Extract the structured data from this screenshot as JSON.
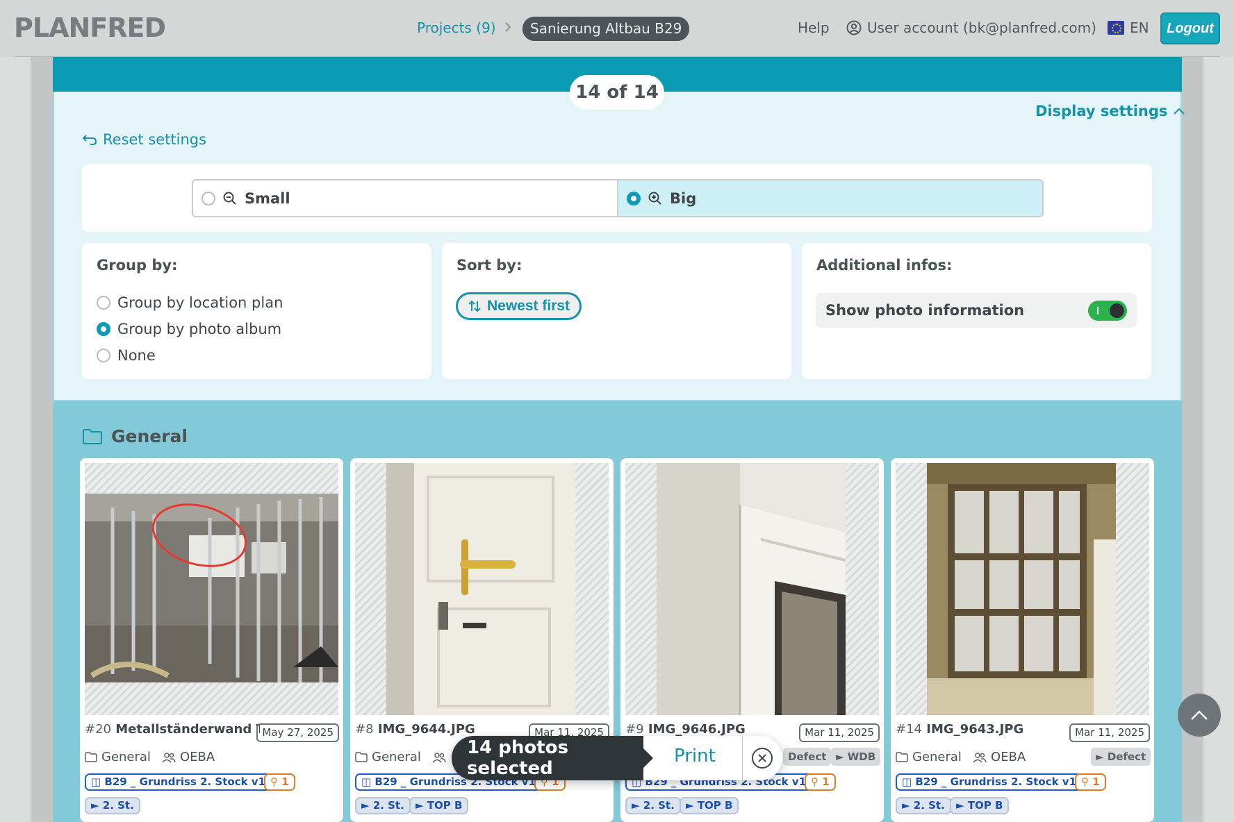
{
  "header": {
    "logo": "PLANFRED",
    "breadcrumb": {
      "projects": "Projects (9)",
      "separator": ">",
      "current": "Sanierung Altbau B29"
    },
    "help": "Help",
    "account": "User account (bk@planfred.com)",
    "language": "EN",
    "logout": "Logout"
  },
  "panel": {
    "count": "14 of 14",
    "display_settings": "Display settings",
    "reset_settings": "Reset settings",
    "size_options": [
      {
        "label": "Small",
        "selected": false
      },
      {
        "label": "Big",
        "selected": true
      }
    ],
    "group_by": {
      "title": "Group by:",
      "options": [
        {
          "label": "Group by location plan",
          "selected": false
        },
        {
          "label": "Group by photo album",
          "selected": true
        },
        {
          "label": "None",
          "selected": false
        }
      ]
    },
    "sort_by": {
      "title": "Sort by:",
      "value": "Newest first"
    },
    "additional": {
      "title": "Additional infos:",
      "show_photo_info": "Show photo information",
      "enabled": true
    }
  },
  "album": {
    "title": "General",
    "photos": [
      {
        "num": "#20",
        "title": "Metallständerwand T...",
        "date": "May 27, 2025",
        "album": "General",
        "company": "OEBA",
        "tags_grey": [],
        "plan": "B29 _ Grundriss 2. Stock v1",
        "pins": "1",
        "tags": [
          "2. St."
        ]
      },
      {
        "num": "#8",
        "title": "IMG_9644.JPG",
        "date": "Mar 11, 2025",
        "album": "General",
        "company": "",
        "tags_grey": [],
        "plan": "B29 _ Grundriss 2. Stock v1",
        "pins": "1",
        "tags": [
          "2. St.",
          "TOP B"
        ]
      },
      {
        "num": "#9",
        "title": "IMG_9646.JPG",
        "date": "Mar 11, 2025",
        "album": "",
        "company": "",
        "tags_grey": [
          "Defect",
          "WDB"
        ],
        "plan": "B29 _ Grundriss 2. Stock v1",
        "pins": "1",
        "tags": [
          "2. St.",
          "TOP B"
        ]
      },
      {
        "num": "#14",
        "title": "IMG_9643.JPG",
        "date": "Mar 11, 2025",
        "album": "General",
        "company": "OEBA",
        "tags_grey": [
          "Defect"
        ],
        "plan": "B29 _ Grundriss 2. Stock v1",
        "pins": "1",
        "tags": [
          "2. St.",
          "TOP B"
        ]
      }
    ]
  },
  "selection": {
    "label": "14 photos selected",
    "print": "Print"
  },
  "icons": {
    "search_minus": "zoom-out-icon",
    "search_plus": "zoom-in-icon",
    "folder": "folder-icon",
    "user": "user-circle-icon",
    "group": "users-icon",
    "plan": "map-icon",
    "pin": "pin-icon",
    "tag": "tag-icon",
    "close": "close-circle-icon",
    "arrow_up": "chevron-up-icon"
  },
  "colors": {
    "accent": "#1593a8",
    "teal": "#0b9bb4",
    "toggle_on": "#2bb24c",
    "chip_blue": "#1d5cc9",
    "chip_orange": "#e27b27"
  }
}
